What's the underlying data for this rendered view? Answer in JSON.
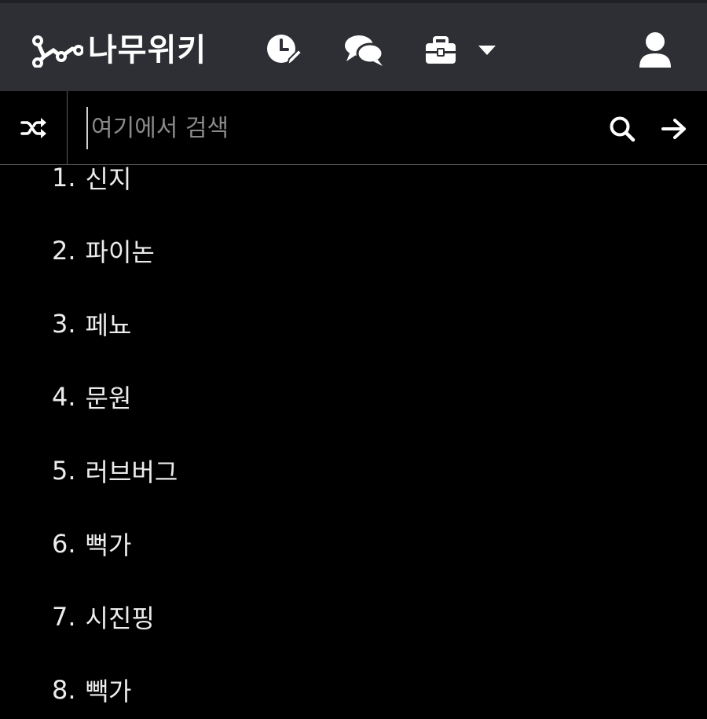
{
  "header": {
    "logo_text": "나무위키",
    "icons": [
      "logo-tree-icon",
      "recent-changes-icon",
      "discussion-icon",
      "tools-icon",
      "caret-down-icon",
      "user-icon"
    ]
  },
  "search": {
    "placeholder": "여기에서 검색",
    "value": ""
  },
  "ranking": [
    {
      "num": "1.",
      "term": "신지"
    },
    {
      "num": "2.",
      "term": "파이논"
    },
    {
      "num": "3.",
      "term": "페뇨"
    },
    {
      "num": "4.",
      "term": "문원"
    },
    {
      "num": "5.",
      "term": "러브버그"
    },
    {
      "num": "6.",
      "term": "뻑가"
    },
    {
      "num": "7.",
      "term": "시진핑"
    },
    {
      "num": "8.",
      "term": "빽가"
    }
  ],
  "colors": {
    "navbar_bg": "#2d2f34",
    "page_bg": "#000000",
    "text": "#ececec",
    "placeholder": "#8a8a8a"
  }
}
